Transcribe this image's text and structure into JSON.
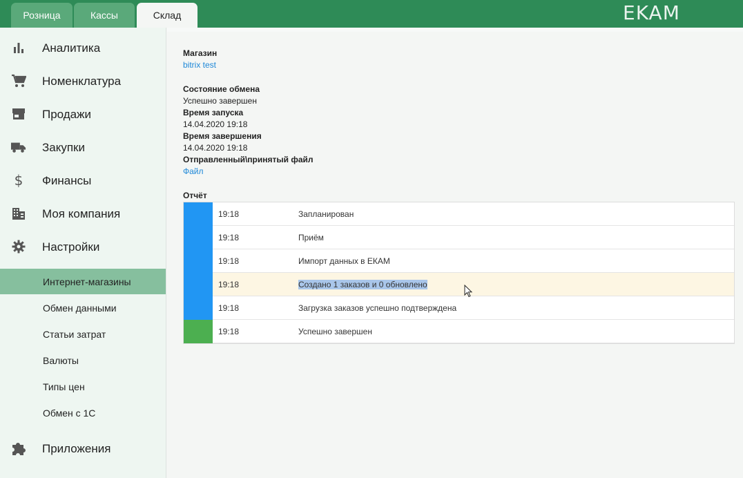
{
  "header": {
    "tabs": [
      {
        "label": "Розница"
      },
      {
        "label": "Кассы"
      },
      {
        "label": "Склад"
      }
    ],
    "logo": "EKAM"
  },
  "sidebar": {
    "items": [
      {
        "label": "Аналитика",
        "icon": "bar-chart-icon"
      },
      {
        "label": "Номенклатура",
        "icon": "cart-icon"
      },
      {
        "label": "Продажи",
        "icon": "store-icon"
      },
      {
        "label": "Закупки",
        "icon": "truck-icon"
      },
      {
        "label": "Финансы",
        "icon": "dollar-icon"
      },
      {
        "label": "Моя компания",
        "icon": "building-icon"
      },
      {
        "label": "Настройки",
        "icon": "gear-icon"
      }
    ],
    "sub_items": [
      {
        "label": "Интернет-магазины"
      },
      {
        "label": "Обмен данными"
      },
      {
        "label": "Статьи затрат"
      },
      {
        "label": "Валюты"
      },
      {
        "label": "Типы цен"
      },
      {
        "label": "Обмен с 1С"
      }
    ],
    "apps": {
      "label": "Приложения",
      "icon": "puzzle-icon"
    }
  },
  "details": {
    "store_label": "Магазин",
    "store_value": "bitrix test",
    "status_label": "Состояние обмена",
    "status_value": "Успешно завершен",
    "start_label": "Время запуска",
    "start_value": "14.04.2020 19:18",
    "end_label": "Время завершения",
    "end_value": "14.04.2020 19:18",
    "file_label": "Отправленный\\принятый файл",
    "file_value": "Файл"
  },
  "report": {
    "title": "Отчёт",
    "rows": [
      {
        "time": "19:18",
        "message": "Запланирован",
        "status_color": "#2196f3"
      },
      {
        "time": "19:18",
        "message": "Приём",
        "status_color": "#2196f3"
      },
      {
        "time": "19:18",
        "message": "Импорт данных в ЕКАМ",
        "status_color": "#2196f3"
      },
      {
        "time": "19:18",
        "message": "Создано 1 заказов и 0 обновлено",
        "status_color": "#2196f3"
      },
      {
        "time": "19:18",
        "message": "Загрузка заказов успешно подтверждена",
        "status_color": "#2196f3"
      },
      {
        "time": "19:18",
        "message": "Успешно завершен",
        "status_color": "#4caf50"
      }
    ]
  },
  "colors": {
    "brand": "#2e8b57",
    "active_sub_item": "#86bf9e",
    "link": "#1e88d8"
  }
}
